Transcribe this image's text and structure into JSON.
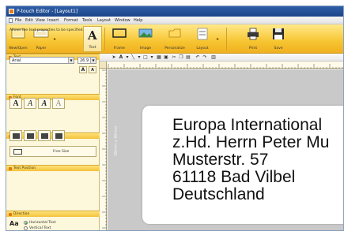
{
  "window": {
    "title": "P-touch Editor - [Layout1]"
  },
  "menu": [
    "File",
    "Edit",
    "View",
    "Insert",
    "Format",
    "Tools",
    "Layout",
    "Window",
    "Help"
  ],
  "ribbon": {
    "new_open": "New/Open",
    "paper": "Paper",
    "text": "Text",
    "frame": "Frame",
    "image": "Image",
    "personalize": "Personalize",
    "layout": "Layout",
    "print": "Print",
    "save": "Save"
  },
  "panel": {
    "text_section": "Text",
    "note": "Allows the text properties to be specified.",
    "font_section": "Font",
    "font_name": "Arial",
    "font_size": "26.9",
    "style_section": "Style",
    "style_buttons": [
      "A",
      "A",
      "A",
      "A"
    ],
    "text_position_section": "Text Position",
    "free_size": "Free Size",
    "direction_section": "Direction",
    "horizontal": "Horizontal Text",
    "vertical": "Vertical Text"
  },
  "canvas": {
    "dimension_label": "38mm x 90mm",
    "address_lines": [
      "Europa International",
      "z.Hd. Herrn Peter Mu",
      "Musterstr. 57",
      "61118 Bad Vilbel",
      "Deutschland"
    ]
  },
  "colors": {
    "ribbon": "#f7c531",
    "panel": "#fdf7dc",
    "titlebar": "#2f5fa8",
    "canvas": "#c9c9c9"
  }
}
